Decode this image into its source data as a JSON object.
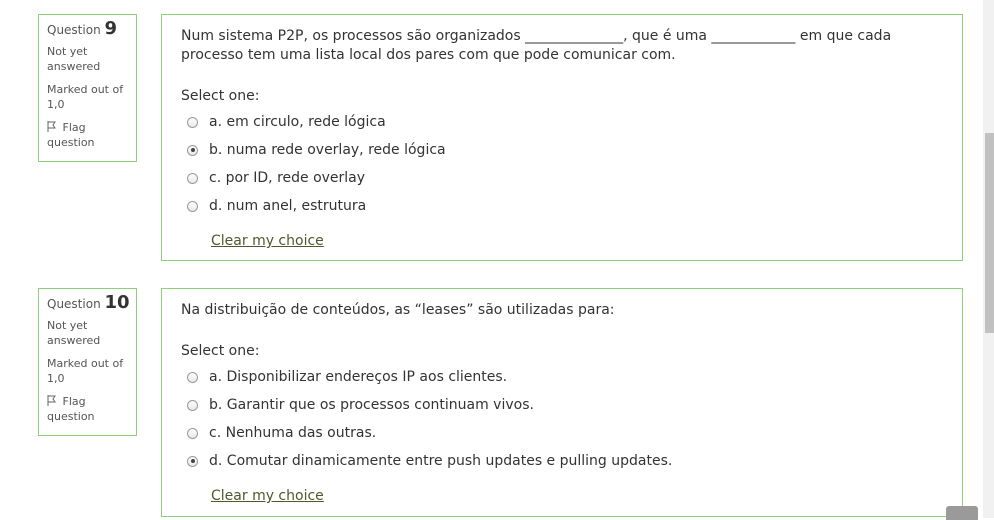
{
  "questions": [
    {
      "label": "Question",
      "number": "9",
      "state": "Not yet answered",
      "grade": "Marked out of 1,0",
      "flag": "Flag question",
      "text": "Num sistema P2P, os processos são organizados ______________, que é uma ____________ em que cada processo tem uma lista local dos pares com que pode comunicar com.",
      "prompt": "Select one:",
      "answers": [
        {
          "label": "a. em circulo, rede lógica",
          "checked": false
        },
        {
          "label": "b. numa rede overlay, rede lógica",
          "checked": true
        },
        {
          "label": "c. por ID, rede overlay",
          "checked": false
        },
        {
          "label": "d. num anel, estrutura",
          "checked": false
        }
      ],
      "clear": "Clear my choice"
    },
    {
      "label": "Question",
      "number": "10",
      "state": "Not yet answered",
      "grade": "Marked out of 1,0",
      "flag": "Flag question",
      "text": "Na distribuição de conteúdos, as “leases” são utilizadas para:",
      "prompt": "Select one:",
      "answers": [
        {
          "label": "a. Disponibilizar endereços IP aos clientes.",
          "checked": false
        },
        {
          "label": "b. Garantir que os processos continuam vivos.",
          "checked": false
        },
        {
          "label": "c. Nenhuma das outras.",
          "checked": false
        },
        {
          "label": "d. Comutar dinamicamente entre push updates e pulling updates.",
          "checked": true
        }
      ],
      "clear": "Clear my choice"
    }
  ]
}
